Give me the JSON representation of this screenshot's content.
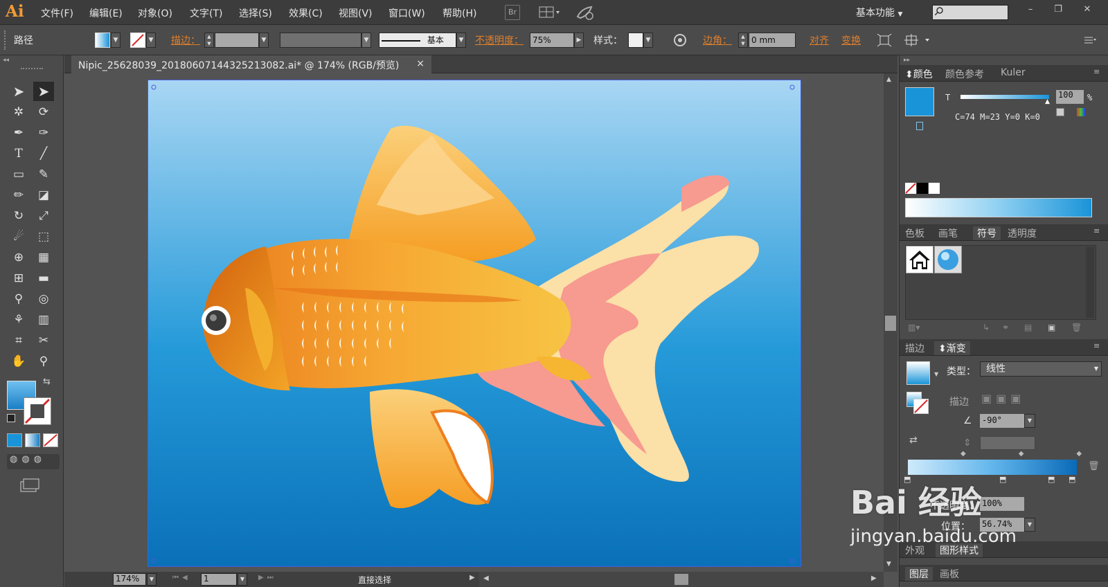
{
  "app": {
    "logo": "Ai"
  },
  "menu": {
    "items": [
      "文件(F)",
      "编辑(E)",
      "对象(O)",
      "文字(T)",
      "选择(S)",
      "效果(C)",
      "视图(V)",
      "窗口(W)",
      "帮助(H)"
    ]
  },
  "menubar": {
    "bridge_label": "Br",
    "workspace": "基本功能",
    "search_placeholder": "",
    "minimize": "–",
    "restore": "❐",
    "close": "✕"
  },
  "control": {
    "object_type": "路径",
    "stroke_label": "描边：",
    "stroke_preset": "基本",
    "opacity_label": "不透明度：",
    "opacity_value": "75%",
    "style_label": "样式：",
    "corner_label": "边角：",
    "corner_value": "0 mm",
    "align_label": "对齐",
    "transform_label": "变换"
  },
  "document": {
    "tab_title": "Nipic_25628039_20180607144325213082.ai* @ 174% (RGB/预览)",
    "close": "×"
  },
  "status": {
    "zoom": "174%",
    "page": "1",
    "tool_name": "直接选择"
  },
  "color_panel": {
    "tabs": [
      "颜色",
      "颜色参考",
      "Kuler"
    ],
    "tint_label": "T",
    "tint_value": "100",
    "percent": "%",
    "cmyk_readout": "C=74 M=23 Y=0 K=0",
    "fill_color": "#1a94d8"
  },
  "swatch_panel": {
    "tabs": [
      "色板",
      "画笔",
      "符号",
      "透明度"
    ]
  },
  "gradient_panel": {
    "tabs": [
      "描边",
      "渐变"
    ],
    "type_label": "类型：",
    "type_value": "线性",
    "stroke_label": "描边",
    "angle_value": "-90°",
    "opacity_label": "不透明度：",
    "opacity_value": "100%",
    "location_label": "位置：",
    "location_value": "56.74%"
  },
  "bottom_panels": {
    "tabs_a": [
      "外观",
      "图形样式"
    ],
    "tabs_b": [
      "图层",
      "画板"
    ]
  },
  "watermark": {
    "text": "Bai 经验",
    "url": "jingyan.baidu.com"
  }
}
